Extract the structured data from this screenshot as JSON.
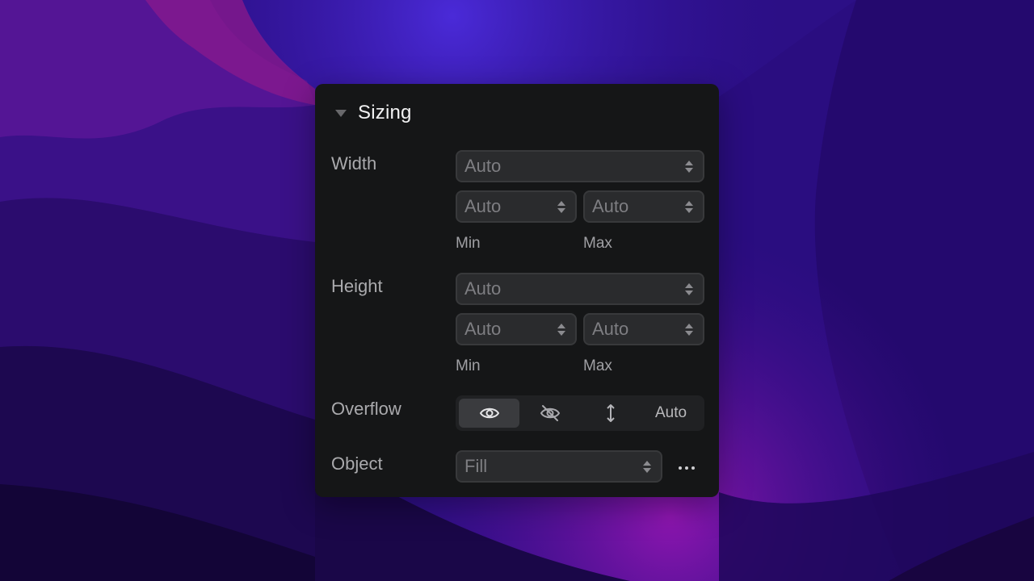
{
  "panel": {
    "title": "Sizing"
  },
  "width": {
    "label": "Width",
    "value": "Auto",
    "min_value": "Auto",
    "max_value": "Auto",
    "min_label": "Min",
    "max_label": "Max"
  },
  "height": {
    "label": "Height",
    "value": "Auto",
    "min_value": "Auto",
    "max_value": "Auto",
    "min_label": "Min",
    "max_label": "Max"
  },
  "overflow": {
    "label": "Overflow",
    "options": [
      {
        "icon": "eye-icon",
        "selected": true
      },
      {
        "icon": "eye-off-icon",
        "selected": false
      },
      {
        "icon": "vertical-arrows-icon",
        "selected": false
      },
      {
        "label": "Auto",
        "selected": false
      }
    ]
  },
  "object": {
    "label": "Object",
    "value": "Fill",
    "more_icon": "more-horizontal-icon"
  },
  "colors": {
    "panel_bg": "#151617",
    "field_bg": "#2a2b2d",
    "title": "#f2f2f3"
  }
}
